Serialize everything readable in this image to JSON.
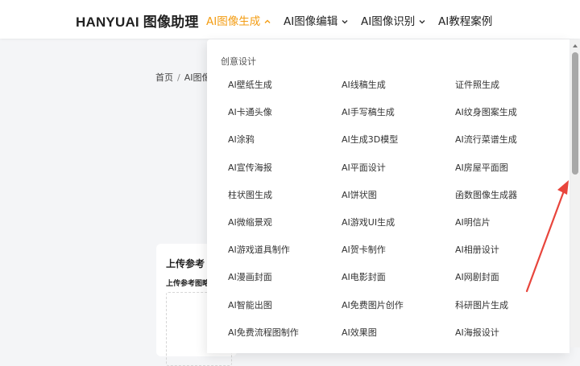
{
  "header": {
    "logo": "HANYUAI 图像助理",
    "nav": [
      {
        "label": "AI图像生成",
        "active": true
      },
      {
        "label": "AI图像编辑",
        "active": false
      },
      {
        "label": "AI图像识别",
        "active": false
      },
      {
        "label": "AI教程案例",
        "active": false
      }
    ]
  },
  "breadcrumb": {
    "home": "首页",
    "current": "AI图像"
  },
  "upload": {
    "title": "上传参考",
    "subtitle": "上传参考图略"
  },
  "dropdown": {
    "section_title": "创意设计",
    "rows": [
      [
        "AI壁纸生成",
        "AI线稿生成",
        "证件照生成"
      ],
      [
        "AI卡通头像",
        "AI手写稿生成",
        "AI纹身图案生成"
      ],
      [
        "AI涂鸦",
        "AI生成3D模型",
        "AI流行菜谱生成"
      ],
      [
        "AI宣传海报",
        "AI平面设计",
        "AI房屋平面图"
      ],
      [
        "柱状图生成",
        "AI饼状图",
        "函数图像生成器"
      ],
      [
        "AI微缩景观",
        "AI游戏UI生成",
        "AI明信片"
      ],
      [
        "AI游戏道具制作",
        "AI贺卡制作",
        "AI相册设计"
      ],
      [
        "AI漫画封面",
        "AI电影封面",
        "AI网剧封面"
      ],
      [
        "AI智能出图",
        "AI免费图片创作",
        "科研图片生成"
      ],
      [
        "AI免费流程图制作",
        "AI效果图",
        "AI海报设计"
      ]
    ]
  },
  "colors": {
    "accent": "#f39c12",
    "annotation": "#e8453c"
  },
  "icons": {
    "nav_chevron": "chevron-down-icon",
    "scroll": "scrollbar"
  }
}
